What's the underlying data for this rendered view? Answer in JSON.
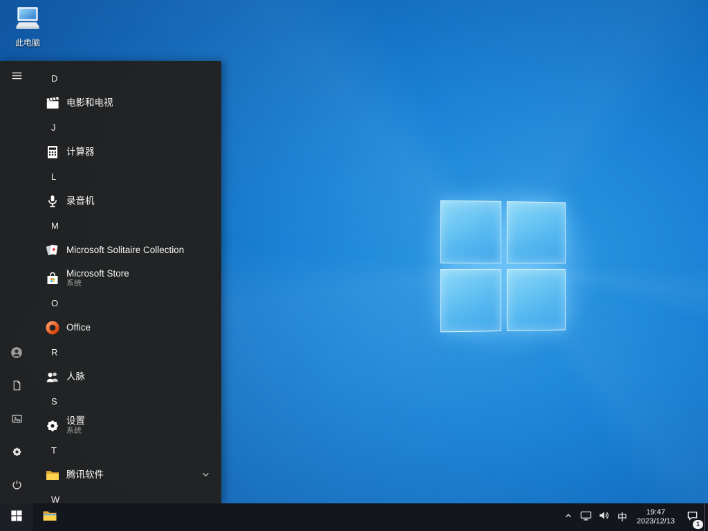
{
  "colors": {
    "desktop_blue": "#1a82d6",
    "menu_bg": "#222222",
    "taskbar_bg": "#14161d",
    "logo_pane_blue": "#55b8f0",
    "folder_yellow": "#ffd34e",
    "office_orange": "#d83b01",
    "subtitle_gray": "#9d9d9d"
  },
  "desktop": {
    "this_pc": {
      "label": "此电脑",
      "icon": "computer-icon"
    }
  },
  "start_menu": {
    "rail": {
      "menu_icon": "hamburger-icon",
      "user_icon": "user-avatar-icon",
      "documents_icon": "document-icon",
      "pictures_icon": "pictures-icon",
      "settings_icon": "gear-icon",
      "power_icon": "power-icon"
    },
    "sections": [
      {
        "letter": "D",
        "apps": [
          {
            "name": "电影和电视",
            "icon": "movies-tv-icon"
          }
        ]
      },
      {
        "letter": "J",
        "apps": [
          {
            "name": "计算器",
            "icon": "calculator-icon"
          }
        ]
      },
      {
        "letter": "L",
        "apps": [
          {
            "name": "录音机",
            "icon": "voice-recorder-icon"
          }
        ]
      },
      {
        "letter": "M",
        "apps": [
          {
            "name": "Microsoft Solitaire Collection",
            "icon": "solitaire-icon"
          },
          {
            "name": "Microsoft Store",
            "subtitle": "系统",
            "icon": "store-icon"
          }
        ]
      },
      {
        "letter": "O",
        "apps": [
          {
            "name": "Office",
            "icon": "office-icon"
          }
        ]
      },
      {
        "letter": "R",
        "apps": [
          {
            "name": "人脉",
            "icon": "people-icon"
          }
        ]
      },
      {
        "letter": "S",
        "apps": [
          {
            "name": "设置",
            "subtitle": "系统",
            "icon": "settings-gear-icon"
          }
        ]
      },
      {
        "letter": "T",
        "apps": [
          {
            "name": "腾讯软件",
            "icon": "folder-icon",
            "expandable": true
          }
        ]
      },
      {
        "letter": "W",
        "apps": []
      }
    ]
  },
  "taskbar": {
    "start_icon": "windows-logo-icon",
    "pinned_icons": [
      "file-explorer-icon"
    ],
    "tray": {
      "hidden_icons_chevron": "chevron-up-icon",
      "network_icon": "network-icon",
      "volume_icon": "speaker-icon",
      "ime": "中",
      "time": "19:47",
      "date": "2023/12/13",
      "action_center_icon": "action-center-icon",
      "action_center_badge": "1"
    }
  }
}
